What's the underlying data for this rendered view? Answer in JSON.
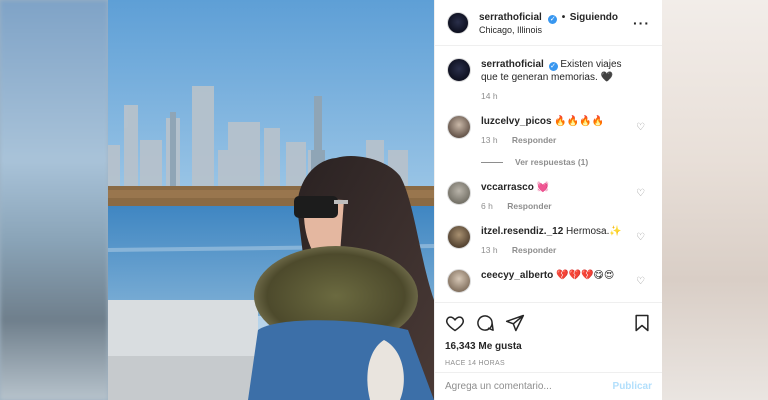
{
  "post": {
    "username": "serrathoficial",
    "follow_state": "Siguiendo",
    "separator": "•",
    "location": "Chicago, Illinois",
    "more_icon": "more-horizontal-icon",
    "caption": "Existen viajes que te generan memorias. 🖤",
    "caption_time": "14 h",
    "likes": "16,343 Me gusta",
    "posted": "HACE 14 HORAS"
  },
  "comments": [
    {
      "username": "luzcelvy_picos",
      "text": "🔥🔥🔥🔥",
      "time": "13 h",
      "reply": "Responder",
      "view_replies": "Ver respuestas (1)"
    },
    {
      "username": "vccarrasco",
      "text": "💓",
      "time": "6 h",
      "reply": "Responder"
    },
    {
      "username": "itzel.resendiz._12",
      "text": "Hermosa.✨",
      "time": "13 h",
      "reply": "Responder"
    },
    {
      "username": "ceecyy_alberto",
      "text": "💔💔💔😋😍",
      "time": "",
      "reply": ""
    }
  ],
  "add_comment": {
    "placeholder": "Agrega un comentario...",
    "publish": "Publicar"
  },
  "colors": {
    "accent": "#3897f0",
    "publish_disabled": "#b2dffc",
    "text": "#262626",
    "muted": "#8e8e8e"
  }
}
